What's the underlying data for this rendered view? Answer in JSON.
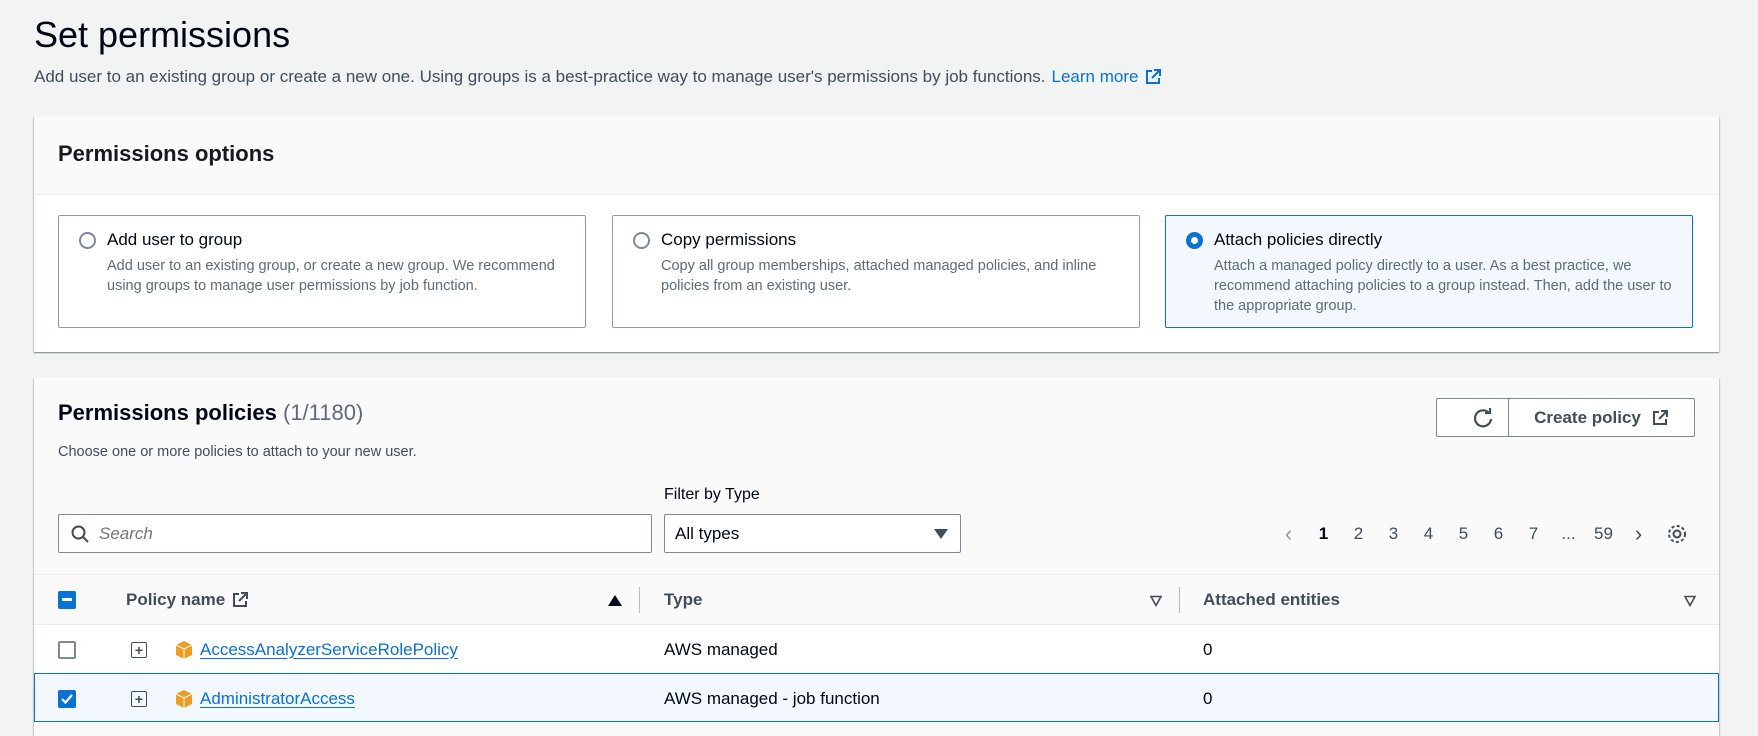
{
  "page": {
    "title": "Set permissions",
    "description": "Add user to an existing group or create a new one. Using groups is a best-practice way to manage user's permissions by job functions.",
    "learn_more": "Learn more"
  },
  "options": {
    "header": "Permissions options",
    "items": [
      {
        "title": "Add user to group",
        "desc": "Add user to an existing group, or create a new group. We recommend using groups to manage user permissions by job function.",
        "selected": false
      },
      {
        "title": "Copy permissions",
        "desc": "Copy all group memberships, attached managed policies, and inline policies from an existing user.",
        "selected": false
      },
      {
        "title": "Attach policies directly",
        "desc": "Attach a managed policy directly to a user. As a best practice, we recommend attaching policies to a group instead. Then, add the user to the appropriate group.",
        "selected": true
      }
    ]
  },
  "policies": {
    "title": "Permissions policies",
    "count": "(1/1180)",
    "description": "Choose one or more policies to attach to your new user.",
    "create_label": "Create policy",
    "search_placeholder": "Search",
    "filter_label": "Filter by Type",
    "filter_value": "All types",
    "pagination": {
      "pages": [
        "1",
        "2",
        "3",
        "4",
        "5",
        "6",
        "7",
        "...",
        "59"
      ],
      "current": "1"
    },
    "columns": {
      "name": "Policy name",
      "type": "Type",
      "entities": "Attached entities"
    },
    "rows": [
      {
        "name": "AccessAnalyzerServiceRolePolicy",
        "type": "AWS managed",
        "entities": "0",
        "checked": false
      },
      {
        "name": "AdministratorAccess",
        "type": "AWS managed - job function",
        "entities": "0",
        "checked": true
      }
    ]
  },
  "colors": {
    "accent": "#0972d3",
    "selected_bg": "#f2f8fd",
    "policy_icon": "#ec9d24"
  }
}
